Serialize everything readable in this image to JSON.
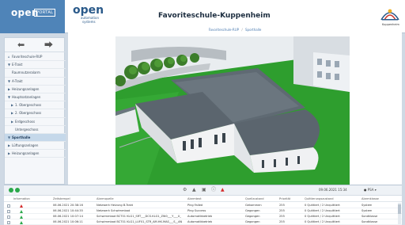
{
  "brand": {
    "open": "open",
    "portal": "PORTAL"
  },
  "logo2": {
    "open": "open",
    "line1": "automation",
    "line2": "systems"
  },
  "page_title": "Favoriteschule-Kuppenheim",
  "school_logo_label": "Kuppenheim",
  "breadcrumb": {
    "item1": "Favoriteschule-RUP",
    "sep": "/",
    "item2": "Sporthalle"
  },
  "nav": [
    {
      "label": "Favoriteschule-RUP",
      "toggle": "",
      "indent": 0,
      "icon": "home-icon"
    },
    {
      "label": "E-Trakt",
      "toggle": "▼",
      "indent": 0
    },
    {
      "label": "Raumnutzeralarm",
      "toggle": "",
      "indent": 0
    },
    {
      "label": "A-Trakt",
      "toggle": "▼",
      "indent": 0
    },
    {
      "label": "Heizungsanlagen",
      "toggle": "▶",
      "indent": 0
    },
    {
      "label": "Hauptsatzanlagen",
      "toggle": "▼",
      "indent": 0
    },
    {
      "label": "1. Obergeschoss",
      "toggle": "▶",
      "indent": 1
    },
    {
      "label": "2. Obergeschoss",
      "toggle": "▶",
      "indent": 1
    },
    {
      "label": "Erdgeschoss",
      "toggle": "▶",
      "indent": 1
    },
    {
      "label": "Untergeschoss",
      "toggle": "",
      "indent": 1
    },
    {
      "label": "Sporthalle",
      "toggle": "▼",
      "indent": 0,
      "active": true
    },
    {
      "label": "Lüftungsanlagen",
      "toggle": "▶",
      "indent": 0
    },
    {
      "label": "Heizungsanlagen",
      "toggle": "▶",
      "indent": 0
    }
  ],
  "alarm": {
    "time": "09.06.2021 15:34",
    "user": "PSA",
    "headers": [
      "Information",
      "Zeitstempel",
      "Alarmquelle",
      "Alarmtext",
      "Quellzustand",
      "Priorität",
      "Quittierungszustand",
      "Alarmklasse"
    ],
    "rows": [
      {
        "severity": "red",
        "cells": [
          "",
          "06.06.2021 20:38:16",
          "Netzwerk Heizung B-Trakt",
          "Ping Failed",
          "Gekommen",
          "255",
          "0 Quittiert / 2 Unquittiert",
          "System"
        ]
      },
      {
        "severity": "green",
        "cells": [
          "",
          "06.06.2021 10:44:35",
          "Netzwerk Schwimmbad",
          "Ping Success",
          "Gegangen",
          "255",
          "0 Quittiert / 2 Unquittiert",
          "System"
        ]
      },
      {
        "severity": "green",
        "cells": [
          "",
          "06.06.2021 10:07:14",
          "Schwimmbad BCT01 KLG1_SRT___DCS.KLG1_ZW0___Y___U_",
          "Automatikbetrieb",
          "Gegangen",
          "255",
          "0 Quittiert / 2 Unquittiert",
          "Sondklasse"
        ]
      },
      {
        "severity": "green",
        "cells": [
          "",
          "06.06.2021 10:06:11",
          "Schwimmbad BCT01 KLG1_LUF01_STR_AM.HK.MAS___S__AN",
          "Automatikbetrieb",
          "Gegangen",
          "255",
          "0 Quittiert / 2 Unquittiert",
          "Sondklasse"
        ]
      }
    ]
  },
  "colors": {
    "brand_blue": "#4f84b8",
    "active_nav": "#c5d8ea",
    "alarm_red": "#d52b2b",
    "alarm_green": "#2aa84a",
    "lawn": "#2e9e2e"
  }
}
